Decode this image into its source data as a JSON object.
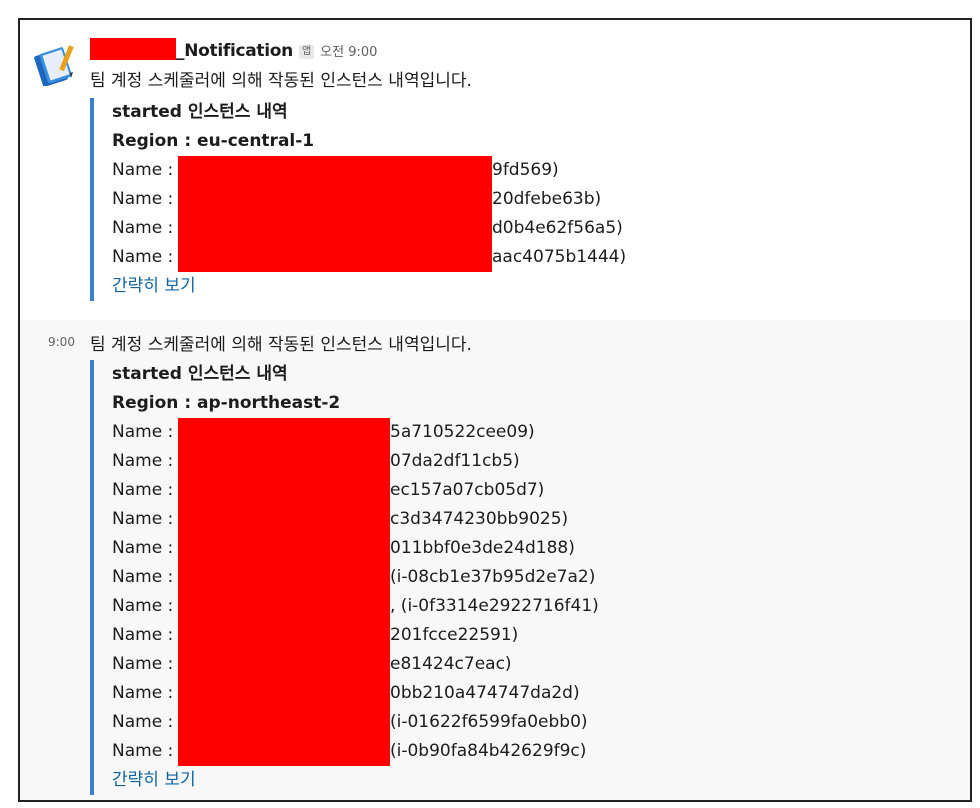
{
  "message1": {
    "sender_suffix": "_Notification",
    "app_badge": "앱",
    "timestamp": "오전 9:00",
    "intro": "팀 계정 스케줄러에 의해 작동된 인스턴스 내역입니다.",
    "title": "started 인스턴스 내역",
    "region": "Region : eu-central-1",
    "name_label": "Name :",
    "rows": [
      {
        "suffix": "9fd569)"
      },
      {
        "suffix": "20dfebe63b)"
      },
      {
        "suffix": "d0b4e62f56a5)"
      },
      {
        "suffix": "aac4075b1444)"
      }
    ],
    "show_less": "간략히 보기"
  },
  "message2": {
    "time": "9:00",
    "intro": "팀 계정 스케줄러에 의해 작동된 인스턴스 내역입니다.",
    "title": "started 인스턴스 내역",
    "region": "Region : ap-northeast-2",
    "name_label": "Name :",
    "rows": [
      {
        "suffix": "5a710522cee09)"
      },
      {
        "suffix": "07da2df11cb5)"
      },
      {
        "suffix": "ec157a07cb05d7)"
      },
      {
        "suffix": "c3d3474230bb9025)"
      },
      {
        "suffix": "011bbf0e3de24d188)"
      },
      {
        "suffix": "(i-08cb1e37b95d2e7a2)"
      },
      {
        "suffix": ", (i-0f3314e2922716f41)"
      },
      {
        "suffix": "201fcce22591)"
      },
      {
        "suffix": "e81424c7eac)"
      },
      {
        "suffix": "0bb210a474747da2d)"
      },
      {
        "suffix": "(i-01622f6599fa0ebb0)"
      },
      {
        "suffix": "(i-0b90fa84b42629f9c)"
      }
    ],
    "show_less": "간략히 보기"
  },
  "colors": {
    "link": "#1264a3",
    "attachment_bar": "#3c82c8",
    "redaction": "#ff0000",
    "hover_bg": "#f8f8f8"
  },
  "icons": {
    "avatar": "notebook-app-icon"
  }
}
